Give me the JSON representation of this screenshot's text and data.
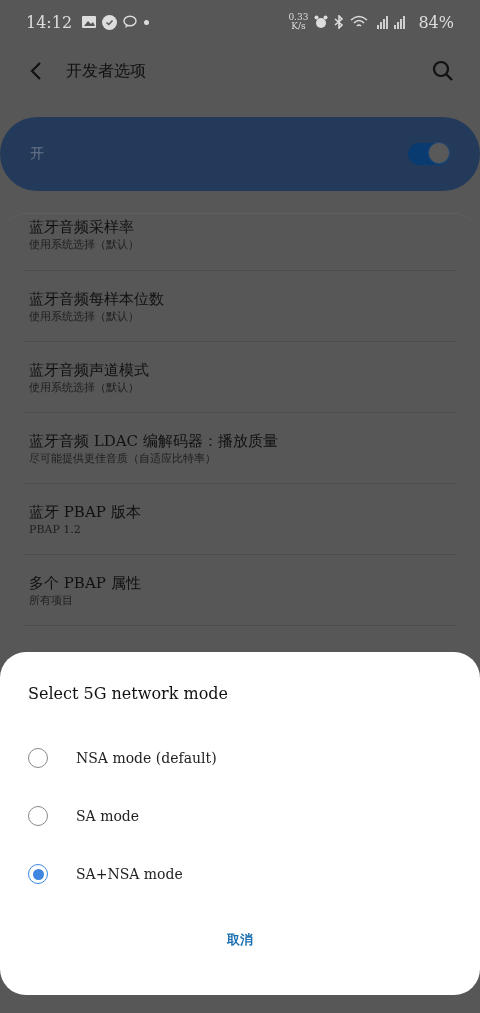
{
  "status_bar": {
    "time": "14:12",
    "speed_value": "0.33",
    "speed_unit": "K/s",
    "battery": "84%"
  },
  "app_bar": {
    "title": "开发者选项"
  },
  "master_switch": {
    "label": "开",
    "on": true
  },
  "settings": [
    {
      "title": "蓝牙音频采样率",
      "subtitle": "使用系统选择（默认）"
    },
    {
      "title": "蓝牙音频每样本位数",
      "subtitle": "使用系统选择（默认）"
    },
    {
      "title": "蓝牙音频声道模式",
      "subtitle": "使用系统选择（默认）"
    },
    {
      "title": "蓝牙音频 LDAC 编解码器：播放质量",
      "subtitle": "尽可能提供更佳音质（自适应比特率）"
    },
    {
      "title": "蓝牙 PBAP 版本",
      "subtitle": "PBAP 1.2"
    },
    {
      "title": "多个 PBAP 属性",
      "subtitle": "所有项目"
    }
  ],
  "dialog": {
    "title": "Select 5G network mode",
    "options": [
      {
        "label": "NSA mode (default)",
        "selected": false
      },
      {
        "label": "SA mode",
        "selected": false
      },
      {
        "label": "SA+NSA mode",
        "selected": true
      }
    ],
    "cancel": "取消"
  }
}
